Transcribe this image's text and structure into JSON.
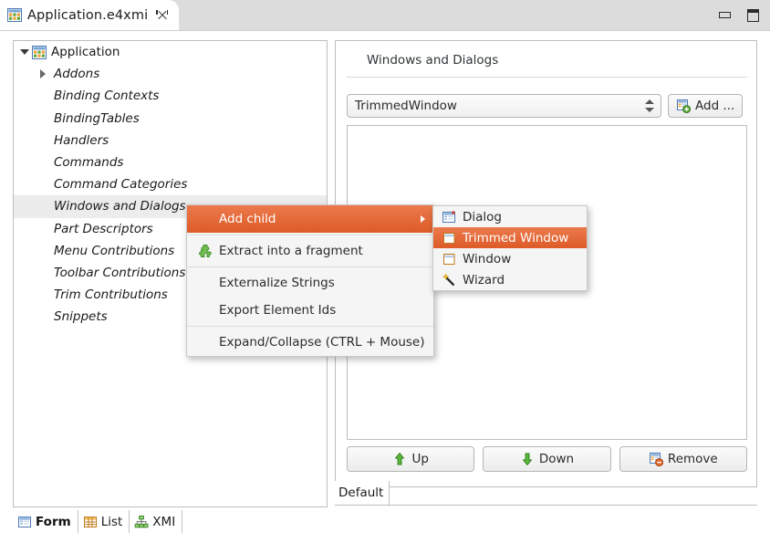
{
  "window": {
    "tab_title": "Application.e4xmi",
    "tab_icon": "application-model-icon",
    "close_icon": "close-icon",
    "minimize_icon": "minimize-icon",
    "maximize_icon": "maximize-icon"
  },
  "tree": {
    "root": {
      "label": "Application",
      "icon": "application-model-icon",
      "expanded": true
    },
    "items": [
      {
        "label": "Addons",
        "has_twisty": true,
        "selected": false
      },
      {
        "label": "Binding Contexts",
        "has_twisty": false,
        "selected": false
      },
      {
        "label": "BindingTables",
        "has_twisty": false,
        "selected": false
      },
      {
        "label": "Handlers",
        "has_twisty": false,
        "selected": false
      },
      {
        "label": "Commands",
        "has_twisty": false,
        "selected": false
      },
      {
        "label": "Command Categories",
        "has_twisty": false,
        "selected": false
      },
      {
        "label": "Windows and Dialogs",
        "has_twisty": false,
        "selected": true
      },
      {
        "label": "Part Descriptors",
        "has_twisty": false,
        "selected": false
      },
      {
        "label": "Menu Contributions",
        "has_twisty": false,
        "selected": false
      },
      {
        "label": "Toolbar Contributions",
        "has_twisty": false,
        "selected": false
      },
      {
        "label": "Trim Contributions",
        "has_twisty": false,
        "selected": false
      },
      {
        "label": "Snippets",
        "has_twisty": false,
        "selected": false
      }
    ]
  },
  "form": {
    "title": "Windows and Dialogs",
    "combo": {
      "value": "TrimmedWindow",
      "icon": "spinner-arrows-icon"
    },
    "add_button": {
      "label": "Add ...",
      "icon": "add-element-icon"
    },
    "buttons": [
      {
        "label": "Up",
        "icon": "arrow-up-icon",
        "name": "up-button"
      },
      {
        "label": "Down",
        "icon": "arrow-down-icon",
        "name": "down-button"
      },
      {
        "label": "Remove",
        "icon": "remove-element-icon",
        "name": "remove-button"
      }
    ],
    "default_tab": "Default"
  },
  "context_menu": {
    "items": [
      {
        "label": "Add child",
        "icon": null,
        "highlight": true,
        "submenu": true,
        "name": "menu-item-add-child"
      },
      {
        "separator": true
      },
      {
        "label": "Extract into a fragment",
        "icon": "puzzle-piece-icon",
        "highlight": false,
        "submenu": false,
        "name": "menu-item-extract-into-a-fragment"
      },
      {
        "separator": true
      },
      {
        "label": "Externalize Strings",
        "icon": null,
        "highlight": false,
        "submenu": false,
        "name": "menu-item-externalize-strings"
      },
      {
        "label": "Export Element Ids",
        "icon": null,
        "highlight": false,
        "submenu": false,
        "name": "menu-item-export-element-ids"
      },
      {
        "separator": true
      },
      {
        "label": "Expand/Collapse (CTRL + Mouse)",
        "icon": null,
        "highlight": false,
        "submenu": false,
        "name": "menu-item-expand-collapse"
      }
    ]
  },
  "submenu": {
    "items": [
      {
        "label": "Dialog",
        "icon": "dialog-icon",
        "highlight": false,
        "name": "submenu-item-dialog"
      },
      {
        "label": "Trimmed Window",
        "icon": "trimmed-window-icon",
        "highlight": true,
        "name": "submenu-item-trimmed-window"
      },
      {
        "label": "Window",
        "icon": "window-icon",
        "highlight": false,
        "name": "submenu-item-window"
      },
      {
        "label": "Wizard",
        "icon": "wizard-wand-icon",
        "highlight": false,
        "name": "submenu-item-wizard"
      }
    ]
  },
  "bottom_tabs": [
    {
      "label": "Form",
      "icon": "form-icon",
      "active": true
    },
    {
      "label": "List",
      "icon": "list-icon",
      "active": false
    },
    {
      "label": "XMI",
      "icon": "xmi-tree-icon",
      "active": false
    }
  ],
  "colors": {
    "menu_highlight_top": "#ec7a4c",
    "menu_highlight_bottom": "#dd5b28",
    "tree_selection": "#ececec",
    "titlebar": "#dcdcdc",
    "panel_border": "#bdbdbd"
  }
}
